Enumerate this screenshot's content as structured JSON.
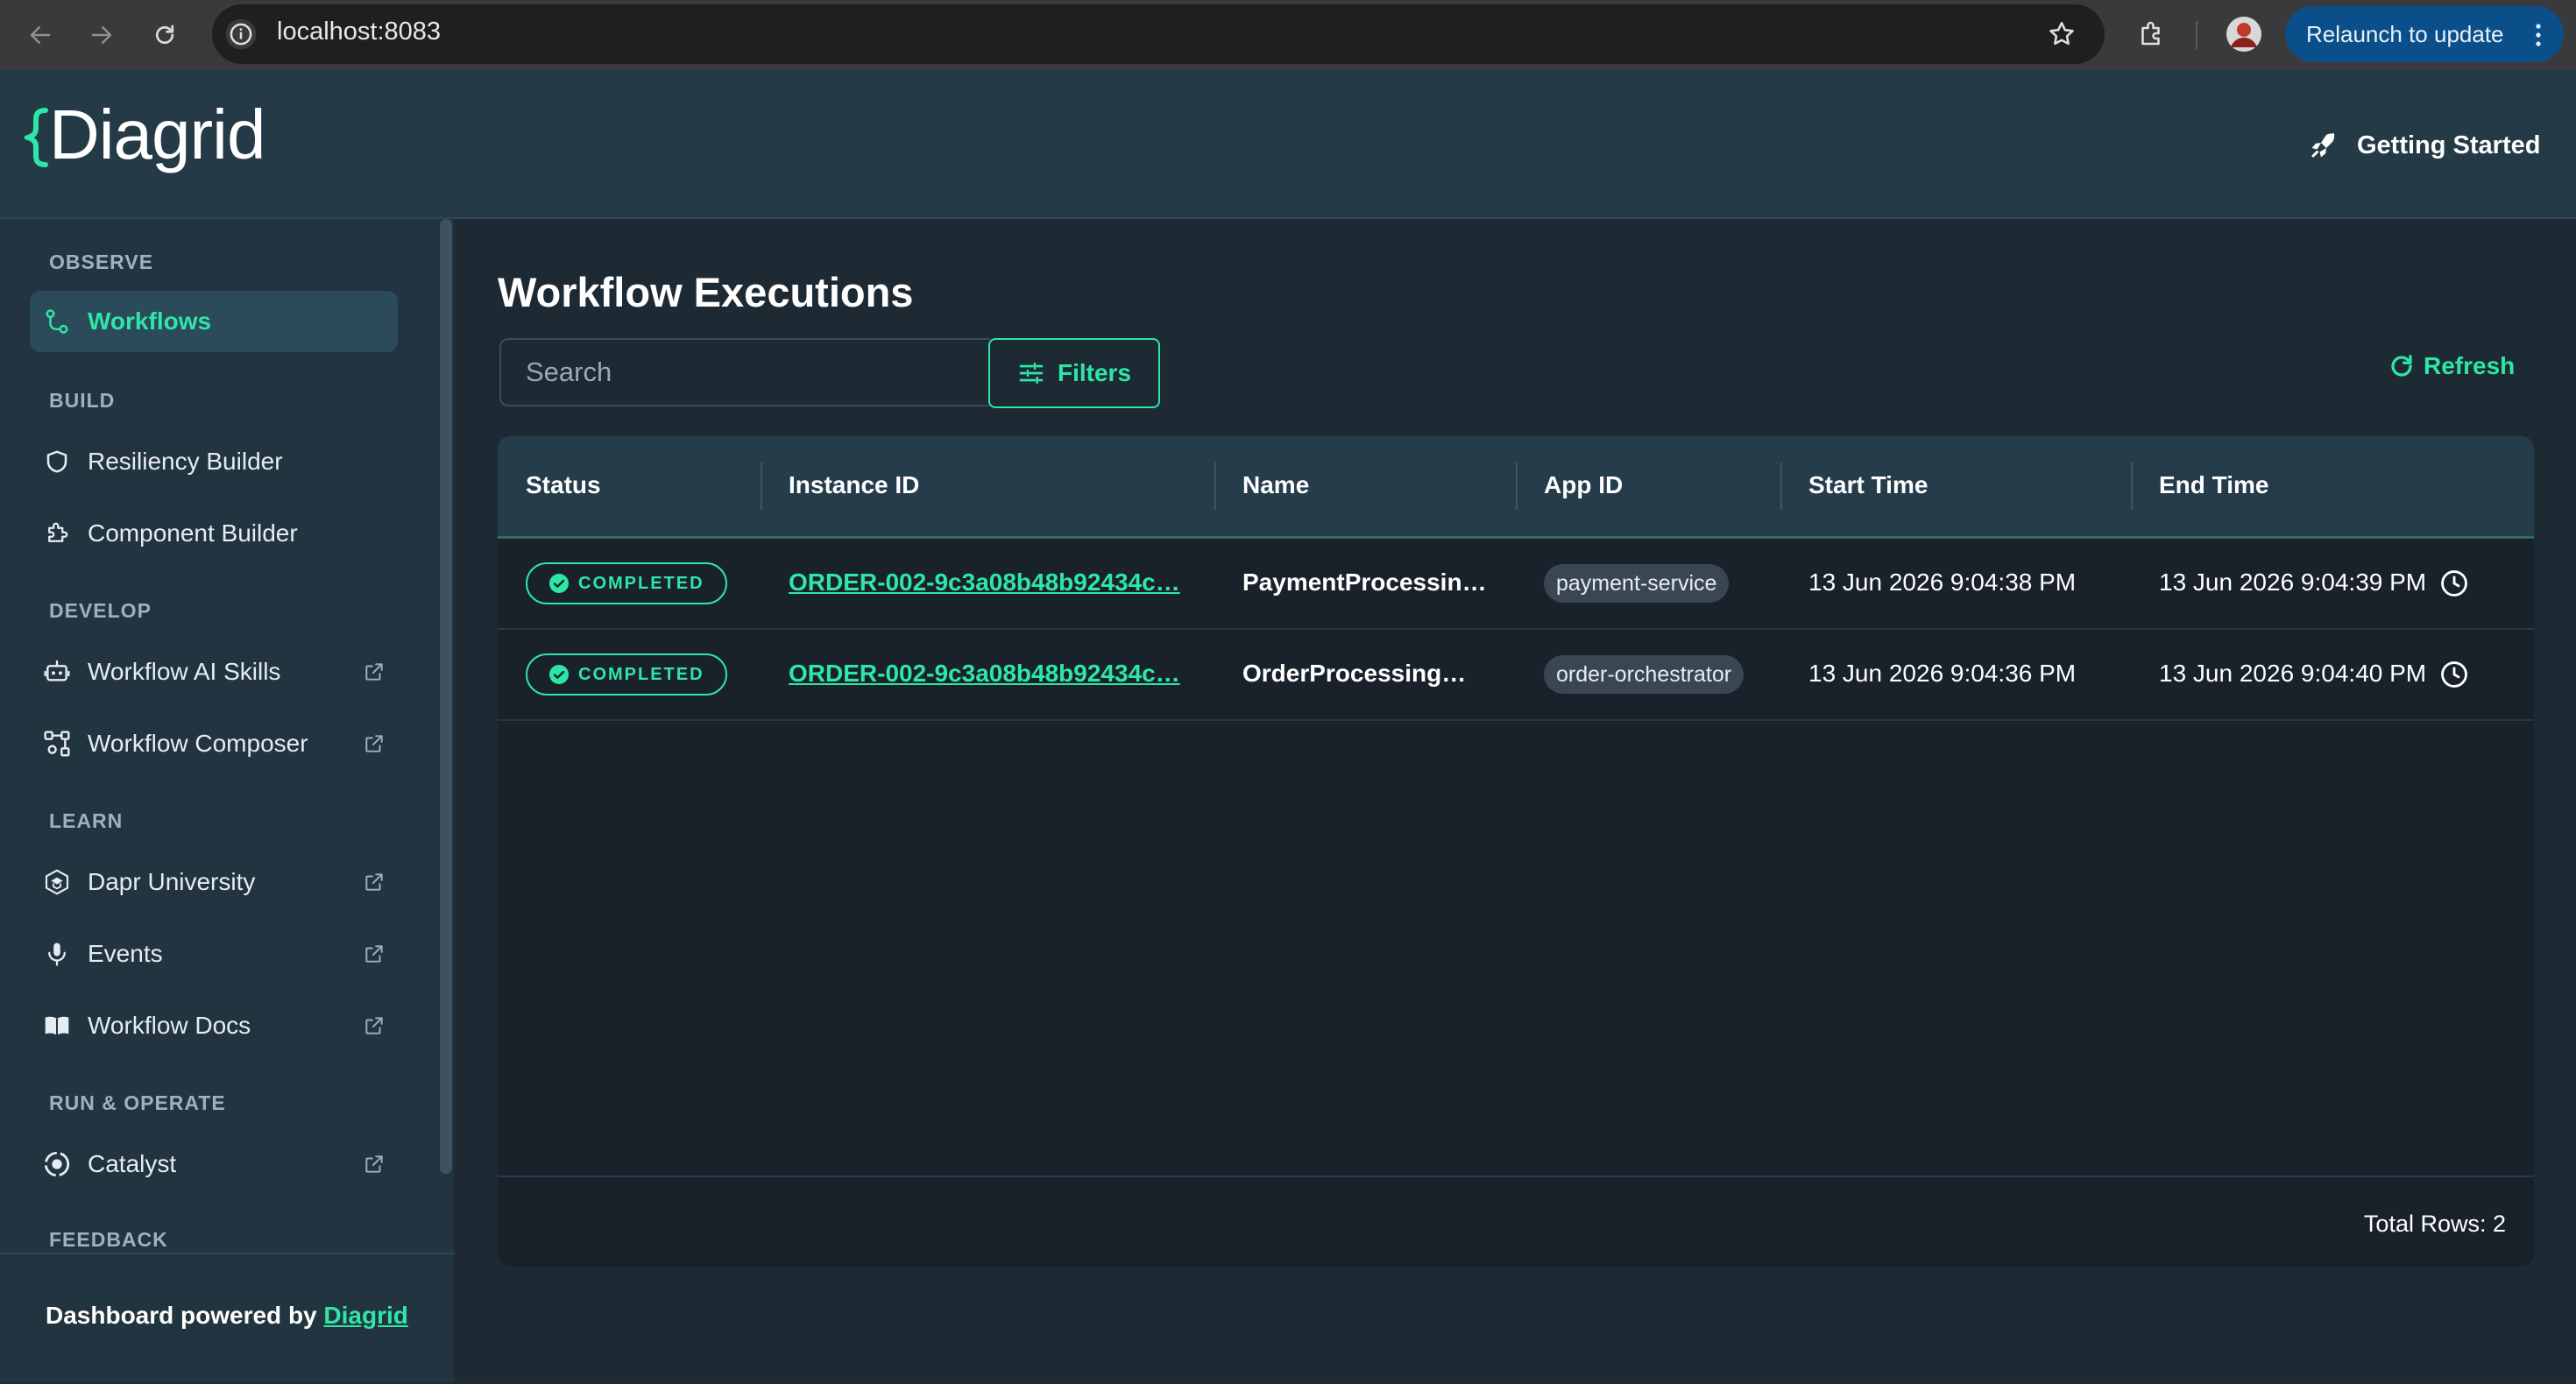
{
  "browser": {
    "url": "localhost:8083",
    "relaunch_label": "Relaunch to update"
  },
  "header": {
    "logo": "Diagrid",
    "getting_started": "Getting Started"
  },
  "sidebar": {
    "sections": {
      "observe": "OBSERVE",
      "build": "BUILD",
      "develop": "DEVELOP",
      "learn": "LEARN",
      "run": "RUN & OPERATE",
      "feedback": "FEEDBACK"
    },
    "items": {
      "workflows": "Workflows",
      "resiliency": "Resiliency Builder",
      "component": "Component Builder",
      "ai_skills": "Workflow AI Skills",
      "composer": "Workflow Composer",
      "university": "Dapr University",
      "events": "Events",
      "docs": "Workflow Docs",
      "catalyst": "Catalyst"
    },
    "footer": {
      "prefix": "Dashboard powered by ",
      "link": "Diagrid"
    }
  },
  "main": {
    "title": "Workflow Executions",
    "search_placeholder": "Search",
    "filters_label": "Filters",
    "refresh_label": "Refresh",
    "columns": {
      "status": "Status",
      "instance_id": "Instance ID",
      "name": "Name",
      "app_id": "App ID",
      "start_time": "Start Time",
      "end_time": "End Time"
    },
    "rows": [
      {
        "status": "COMPLETED",
        "instance_id": "ORDER-002-9c3a08b48b92434c…",
        "name": "PaymentProcessin…",
        "app_id": "payment-service",
        "start_time": "13 Jun 2026 9:04:38 PM",
        "end_time": "13 Jun 2026 9:04:39 PM"
      },
      {
        "status": "COMPLETED",
        "instance_id": "ORDER-002-9c3a08b48b92434c…",
        "name": "OrderProcessing…",
        "app_id": "order-orchestrator",
        "start_time": "13 Jun 2026 9:04:36 PM",
        "end_time": "13 Jun 2026 9:04:40 PM"
      }
    ],
    "total_rows": "Total Rows: 2"
  },
  "colors": {
    "accent": "#2ee6a6",
    "header_bg": "#253a47",
    "sidebar_bg": "#22343f",
    "main_bg": "#1e2a33",
    "relaunch_bg": "#0b4f8a"
  }
}
